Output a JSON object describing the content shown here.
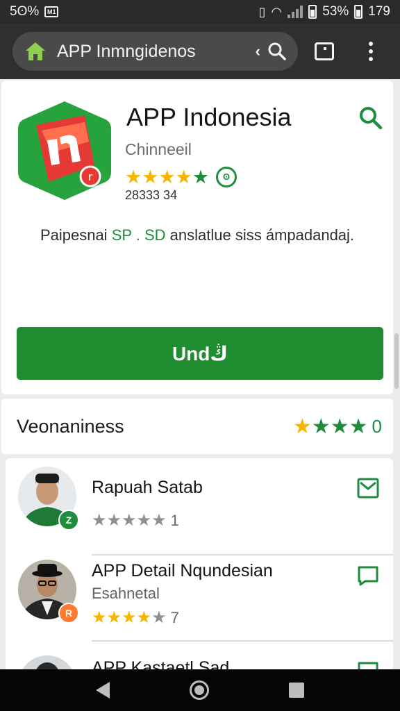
{
  "status_bar": {
    "left_text": "5ʘ%",
    "left_box": "M1",
    "battery_text": "53%",
    "time": "179"
  },
  "app_bar": {
    "title": "APP Inmngidenos",
    "back_glyph": "‹",
    "icons": [
      "home-icon",
      "search-icon",
      "tabs-icon",
      "more-icon"
    ]
  },
  "app": {
    "name": "APP Indonesia",
    "developer": "Chinneeil",
    "rating_stars": 4.5,
    "downloads": "28333 34",
    "description_before": "Paipesnai ",
    "description_highlight": "SP . SD",
    "description_after": " anslatlue siss ámpadandaj.",
    "download_label": "Undڭ"
  },
  "reviews": {
    "title": "Veonaniness",
    "rating_stars": 4,
    "count": "0",
    "items": [
      {
        "name": "Rapuah Satab",
        "role": "",
        "stars": 0,
        "count": "1",
        "badge": "Z"
      },
      {
        "name": "APP Detail Nqundesian",
        "role": "Esahnetal",
        "stars": 4,
        "count": "7",
        "badge": "R"
      },
      {
        "name": "APP Kastaetl Sad",
        "role": "",
        "stars": 0,
        "count": "",
        "badge": ""
      }
    ]
  },
  "colors": {
    "accent_green": "#1e8c2f",
    "star_yellow": "#f7b500",
    "app_bar": "#2f2f2f"
  }
}
